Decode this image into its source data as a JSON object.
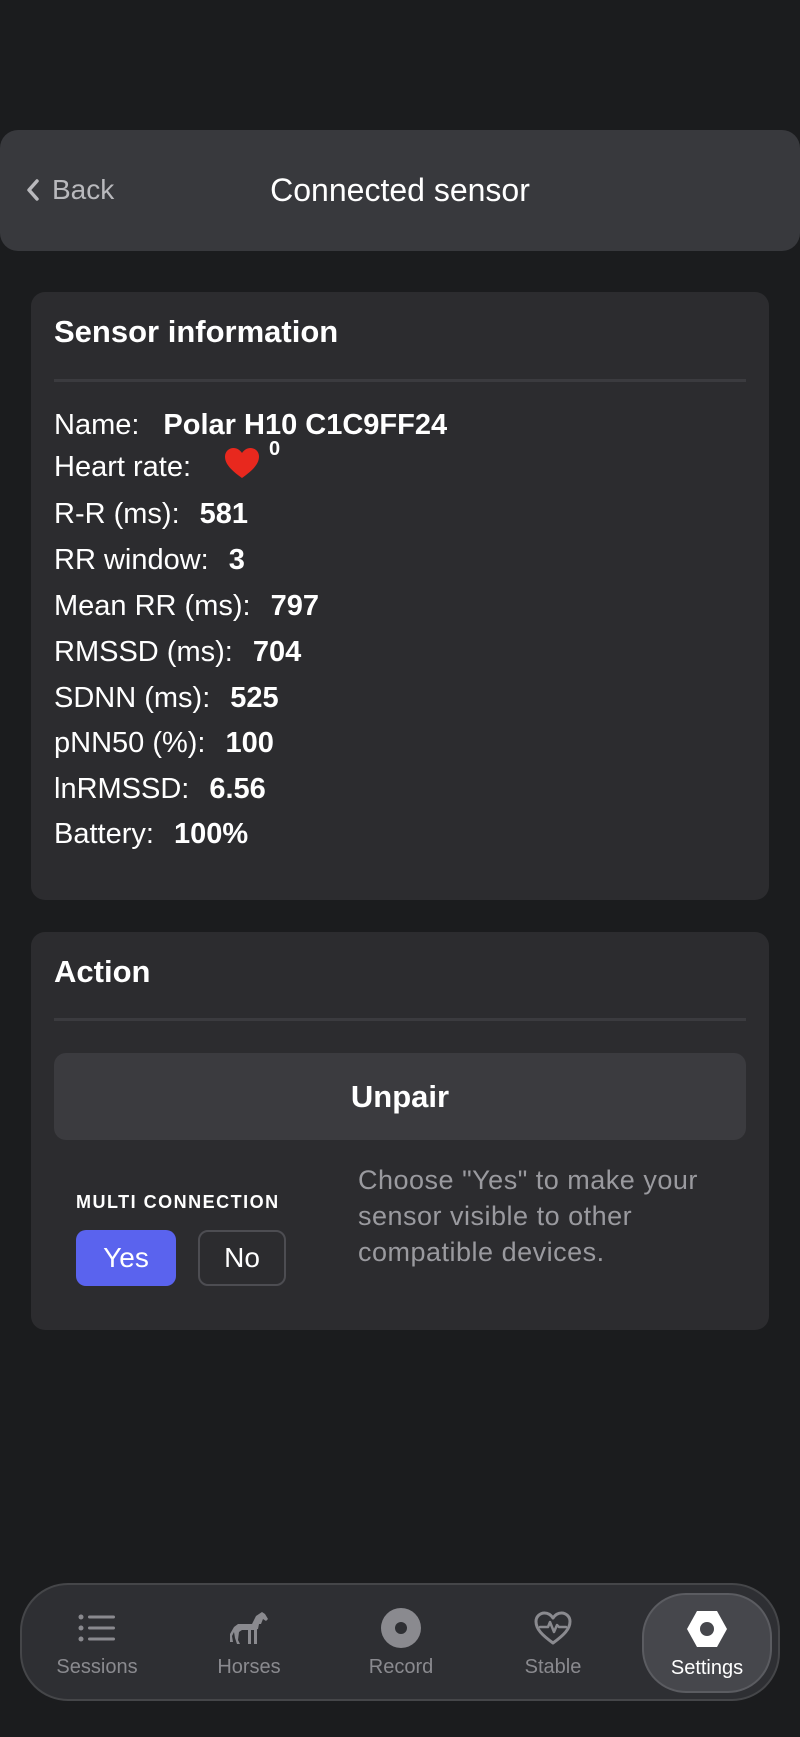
{
  "header": {
    "back_label": "Back",
    "title": "Connected sensor"
  },
  "sensor_info": {
    "title": "Sensor information",
    "rows": [
      {
        "label": "Name:",
        "value": "Polar H10 C1C9FF24"
      },
      {
        "label": "Heart rate:",
        "value": "0"
      },
      {
        "label": "R-R (ms):",
        "value": "581"
      },
      {
        "label": "RR window:",
        "value": "3"
      },
      {
        "label": "Mean RR (ms):",
        "value": "797"
      },
      {
        "label": "RMSSD (ms):",
        "value": "704"
      },
      {
        "label": "SDNN (ms):",
        "value": "525"
      },
      {
        "label": "pNN50 (%):",
        "value": "100"
      },
      {
        "label": "lnRMSSD:",
        "value": "6.56"
      },
      {
        "label": "Battery:",
        "value": "100%"
      }
    ],
    "heart_color": "#e8281e"
  },
  "action": {
    "title": "Action",
    "unpair_label": "Unpair",
    "multi_connection_label": "MULTI CONNECTION",
    "yes_label": "Yes",
    "no_label": "No",
    "selected": "Yes",
    "help_text": "Choose \"Yes\" to make your sensor visible to other compatible devices.",
    "accent_color": "#5a63ee"
  },
  "tabbar": {
    "tabs": [
      {
        "label": "Sessions",
        "icon": "list-icon"
      },
      {
        "label": "Horses",
        "icon": "horse-icon"
      },
      {
        "label": "Record",
        "icon": "record-icon"
      },
      {
        "label": "Stable",
        "icon": "heart-pulse-icon"
      },
      {
        "label": "Settings",
        "icon": "hexagon-nut-icon"
      }
    ],
    "active": "Settings"
  }
}
